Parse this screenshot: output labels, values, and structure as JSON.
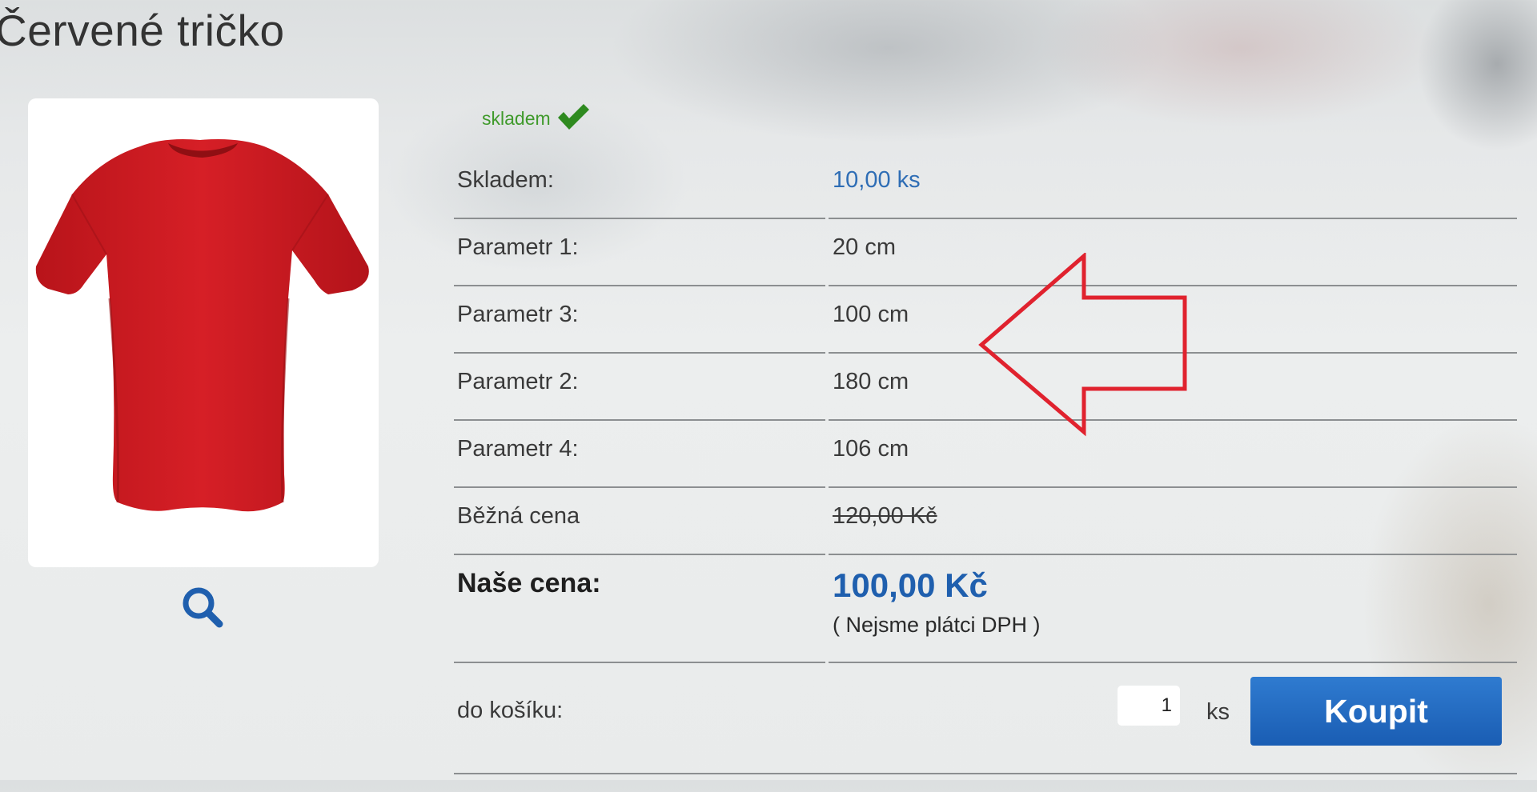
{
  "product": {
    "title": "Červené tričko",
    "image_alt": "red-tshirt"
  },
  "stock": {
    "label": "skladem",
    "icon": "check-icon"
  },
  "params": [
    {
      "key": "Skladem:",
      "value": "10,00 ks",
      "style": "blue"
    },
    {
      "key": "Parametr 1:",
      "value": "20 cm"
    },
    {
      "key": "Parametr 3:",
      "value": "100 cm"
    },
    {
      "key": "Parametr 2:",
      "value": "180 cm"
    },
    {
      "key": "Parametr 4:",
      "value": "106 cm"
    },
    {
      "key": "Běžná cena",
      "value": "120,00 Kč",
      "style": "strike"
    }
  ],
  "price": {
    "label": "Naše cena:",
    "value": "100,00 Kč",
    "note": "( Nejsme plátci DPH )"
  },
  "cart": {
    "label": "do košíku:",
    "quantity": "1",
    "unit": "ks",
    "buy_label": "Koupit"
  },
  "colors": {
    "accent_blue": "#1f5fae",
    "stock_green": "#3f9a2b",
    "annotation_red": "#e0222e"
  }
}
